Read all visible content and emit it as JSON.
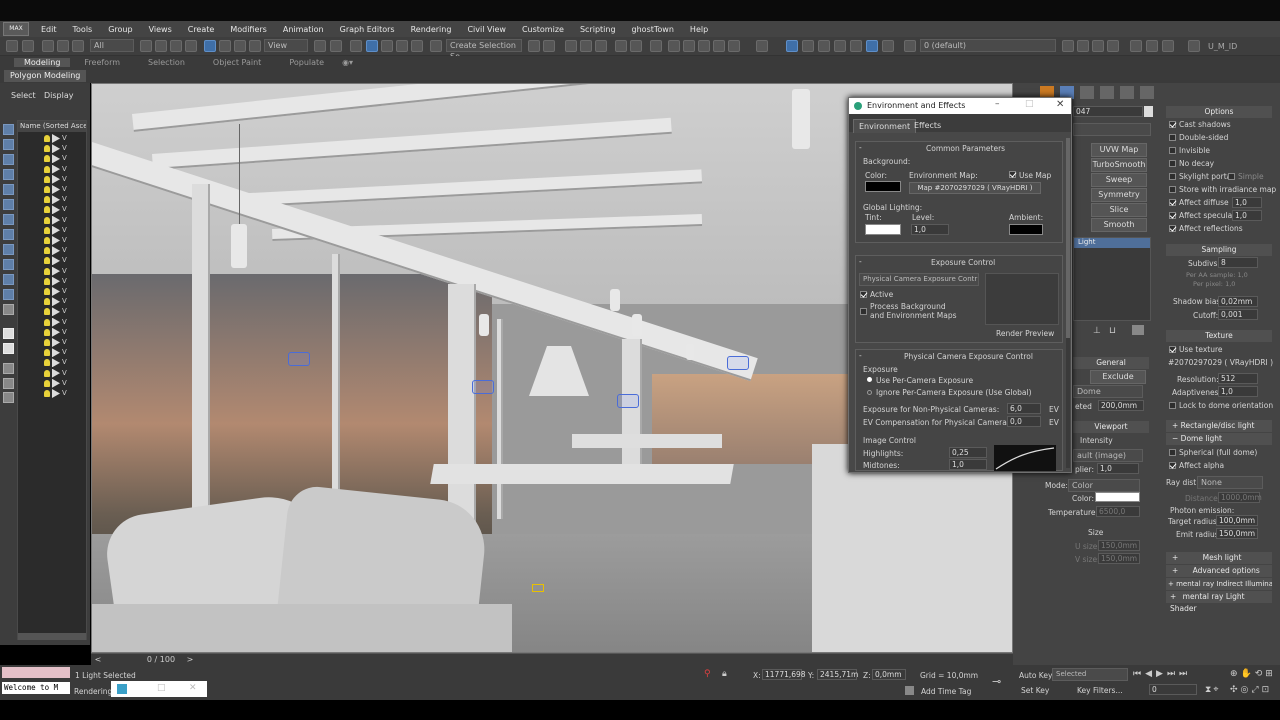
{
  "app": {
    "title_bar_right": "",
    "logo_label": "MAX"
  },
  "menu": [
    "Edit",
    "Tools",
    "Group",
    "Views",
    "Create",
    "Modifiers",
    "Animation",
    "Graph Editors",
    "Rendering",
    "Civil View",
    "Customize",
    "Scripting",
    "ghostTown",
    "Help"
  ],
  "toolbar": {
    "filter_select": "All",
    "view_select": "View",
    "selection_set": "Create Selection Se",
    "layer_select": "0 (default)",
    "workspace": "U_M_ID"
  },
  "ribbon": {
    "tabs": [
      "Modeling",
      "Freeform",
      "Selection",
      "Object Paint",
      "Populate"
    ],
    "active_tab": "Modeling",
    "sub_panel": "Polygon Modeling"
  },
  "scene_explorer": {
    "tab_select": "Select",
    "tab_display": "Display",
    "column_header": "Name (Sorted Ascen",
    "item_prefix": "V"
  },
  "timeline": {
    "frame": "0 / 100"
  },
  "status": {
    "selected_count": "1 Light Selected",
    "prompt": "Rendering",
    "listener": "Welcome to M",
    "x": "11771,698",
    "y": "2415,71m",
    "z": "0,0mm",
    "grid": "Grid = 10,0mm",
    "add_time_tag": "Add Time Tag",
    "autokey": "Auto Key",
    "autokey_select": "Selected",
    "setkey": "Set Key",
    "key_filters": "Key Filters...",
    "frame_field": "0"
  },
  "env_dialog": {
    "title": "Environment and Effects",
    "tabs": [
      "Environment",
      "Effects"
    ],
    "common_params": "Common Parameters",
    "background": "Background:",
    "color_label": "Color:",
    "env_map_label": "Environment Map:",
    "use_map": "Use Map",
    "map_name": "Map #2070297029  ( VRayHDRI )",
    "global_lighting": "Global Lighting:",
    "tint": "Tint:",
    "level": "Level:",
    "level_value": "1,0",
    "ambient": "Ambient:",
    "exposure_control": "Exposure Control",
    "exposure_select": "Physical Camera Exposure Contr",
    "active": "Active",
    "process_bg": "Process Background",
    "process_bg2": "and Environment Maps",
    "render_preview": "Render Preview",
    "phys_cam_exp": "Physical Camera Exposure Control",
    "exposure": "Exposure",
    "use_per_camera": "Use Per-Camera Exposure",
    "ignore_per_camera": "Ignore Per-Camera Exposure (Use Global)",
    "exp_non_phys": "Exposure for Non-Physical Cameras:",
    "exp_non_phys_val": "6,0",
    "ev_comp": "EV Compensation for Physical Cameras:",
    "ev_comp_val": "0,0",
    "ev": "EV",
    "image_control": "Image Control",
    "highlights": "Highlights:",
    "highlights_val": "0,25",
    "midtones": "Midtones:",
    "midtones_val": "1,0"
  },
  "cmd_left": {
    "obj_name": "047",
    "uvw_map": "UVW Map",
    "turbosmooth": "TurboSmooth",
    "sweep": "Sweep",
    "symmetry": "Symmetry",
    "slice": "Slice",
    "smooth": "Smooth",
    "stack_item": "Light",
    "general": "General",
    "exclude": "Exclude",
    "dome": "Dome",
    "targeted": "eted",
    "targeted_val": "200,0mm",
    "viewport": "Viewport",
    "intensity": "Intensity",
    "units": "ault (image)",
    "multiplier": "plier:",
    "multiplier_val": "1,0",
    "mode": "Mode:",
    "mode_val": "Color",
    "color": "Color:",
    "temperature": "Temperature:",
    "temperature_val": "6500,0",
    "size": "Size",
    "usize": "U size:",
    "usize_val": "150,0mm",
    "vsize": "V size:",
    "vsize_val": "150,0mm"
  },
  "cmd_right": {
    "options": "Options",
    "cast_shadows": "Cast shadows",
    "double_sided": "Double-sided",
    "invisible": "Invisible",
    "no_decay": "No decay",
    "skylight_portal": "Skylight portal",
    "simple": "Simple",
    "store_irradiance": "Store with irradiance map",
    "affect_diffuse": "Affect diffuse",
    "affect_diffuse_val": "1,0",
    "affect_specular": "Affect specular",
    "affect_specular_val": "1,0",
    "affect_reflections": "Affect reflections",
    "sampling": "Sampling",
    "subdivs": "Subdivs:",
    "subdivs_val": "8",
    "aa_samples": "Per AA sample: 1,0",
    "per_pixel": "Per pixel: 1,0",
    "shadow_bias": "Shadow bias:",
    "shadow_bias_val": "0,02mm",
    "cutoff": "Cutoff:",
    "cutoff_val": "0,001",
    "texture": "Texture",
    "use_texture": "Use texture",
    "texmap": "#2070297029 ( VRayHDRI )",
    "resolution": "Resolution:",
    "resolution_val": "512",
    "adaptiveness": "Adaptiveness:",
    "adaptiveness_val": "1,0",
    "lock_dome": "Lock to dome orientation",
    "rect_disc": "Rectangle/disc light",
    "dome_light": "Dome light",
    "spherical": "Spherical (full dome)",
    "affect_alpha": "Affect alpha",
    "ray_dist": "Ray dist:",
    "ray_dist_val": "None",
    "distance": "Distance:",
    "distance_val": "1000,0mm",
    "photon": "Photon emission:",
    "target_radius": "Target radius:",
    "target_radius_val": "100,0mm",
    "emit_radius": "Emit radius:",
    "emit_radius_val": "150,0mm",
    "mesh_light": "Mesh light",
    "advanced": "Advanced options",
    "mr_indirect": "mental ray Indirect Illumination",
    "mr_shader": "mental ray Light Shader"
  },
  "colors": {
    "accent": "#3f6fa8",
    "bulb": "#e8d23a",
    "camera": "#4a6cd8"
  }
}
